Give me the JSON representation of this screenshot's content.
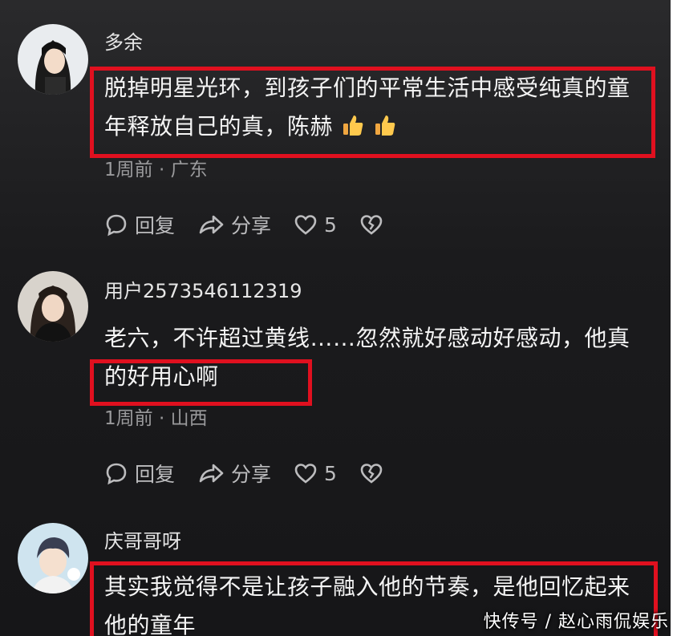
{
  "comments": [
    {
      "username": "多余",
      "text": "脱掉明星光环，到孩子们的平常生活中感受纯真的童年释放自己的真，陈赫",
      "meta": "1周前 · 广东",
      "reply_label": "回复",
      "share_label": "分享",
      "like_count": "5"
    },
    {
      "username": "用户2573546112319",
      "text": "老六，不许超过黄线……忽然就好感动好感动，他真的好用心啊",
      "meta": "1周前 · 山西",
      "reply_label": "回复",
      "share_label": "分享",
      "like_count": "5"
    },
    {
      "username": "庆哥哥呀",
      "text": "其实我觉得不是让孩子融入他的节奏，是他回忆起来他的童年",
      "meta": "",
      "reply_label": "",
      "share_label": "",
      "like_count": ""
    }
  ],
  "watermark": "快传号 / 赵心雨侃娱乐",
  "colors": {
    "background": "#1b1b1d",
    "highlight_box": "#e0101f",
    "text": "#f4f4f4",
    "meta": "#9a9a9c"
  },
  "icons": [
    "comment-bubble-icon",
    "share-arrow-icon",
    "heart-icon",
    "broken-heart-icon",
    "thumbs-up-emoji"
  ]
}
